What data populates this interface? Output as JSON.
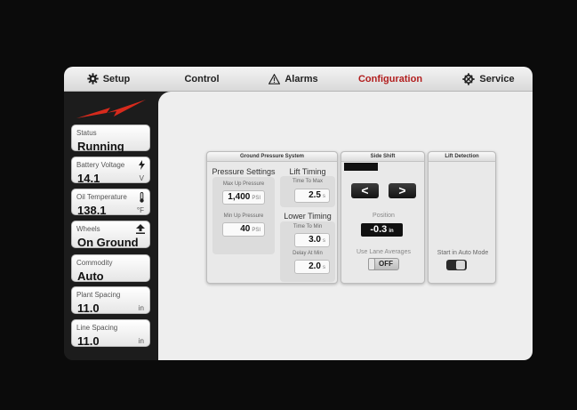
{
  "nav": {
    "tabs": [
      {
        "label": "Setup",
        "icon": "gear-icon"
      },
      {
        "label": "Control",
        "icon": ""
      },
      {
        "label": "Alarms",
        "icon": "warning-icon"
      },
      {
        "label": "Configuration",
        "icon": "",
        "active": true
      },
      {
        "label": "Service",
        "icon": "wrench-gear-icon"
      }
    ],
    "active_color": "#b21e1e"
  },
  "sidebar": {
    "logo_icon": "red-lightning-logo",
    "cards": [
      {
        "label": "Status",
        "value": "Running",
        "unit": "",
        "icon": ""
      },
      {
        "label": "Battery Voltage",
        "value": "14.1",
        "unit": "V",
        "icon": "lightning-icon"
      },
      {
        "label": "Oil Temperature",
        "value": "138.1",
        "unit": "°F",
        "icon": "thermometer-icon"
      },
      {
        "label": "Wheels",
        "value": "On Ground",
        "unit": "",
        "icon": "upload-arrow-icon"
      },
      {
        "label": "Commodity",
        "value": "Auto",
        "unit": "",
        "icon": ""
      },
      {
        "label": "Plant Spacing",
        "value": "11.0",
        "unit": "in",
        "icon": ""
      },
      {
        "label": "Line Spacing",
        "value": "11.0",
        "unit": "in",
        "icon": ""
      }
    ]
  },
  "ground_pressure": {
    "title": "Ground Pressure System",
    "pressure_settings_title": "Pressure Settings",
    "max_up_label": "Max Up Pressure",
    "max_up_value": "1,400",
    "max_up_unit": "PSI",
    "min_up_label": "Min Up Pressure",
    "min_up_value": "40",
    "min_up_unit": "PSI",
    "lift_timing_title": "Lift Timing",
    "time_to_max_label": "Time To Max",
    "time_to_max_value": "2.5",
    "time_to_max_unit": "s",
    "lower_timing_title": "Lower Timing",
    "time_to_min_label": "Time To Min",
    "time_to_min_value": "3.0",
    "time_to_min_unit": "s",
    "delay_at_min_label": "Delay At Min",
    "delay_at_min_value": "2.0",
    "delay_at_min_unit": "s"
  },
  "side_shift": {
    "title": "Side Shift",
    "left_label": "<",
    "right_label": ">",
    "position_label": "Position",
    "position_value": "-0.3",
    "position_unit": "in",
    "lane_avg_label": "Use Lane Averages",
    "lane_avg_state": "OFF"
  },
  "lift_detection": {
    "title": "Lift Detection",
    "auto_mode_label": "Start in Auto Mode"
  }
}
